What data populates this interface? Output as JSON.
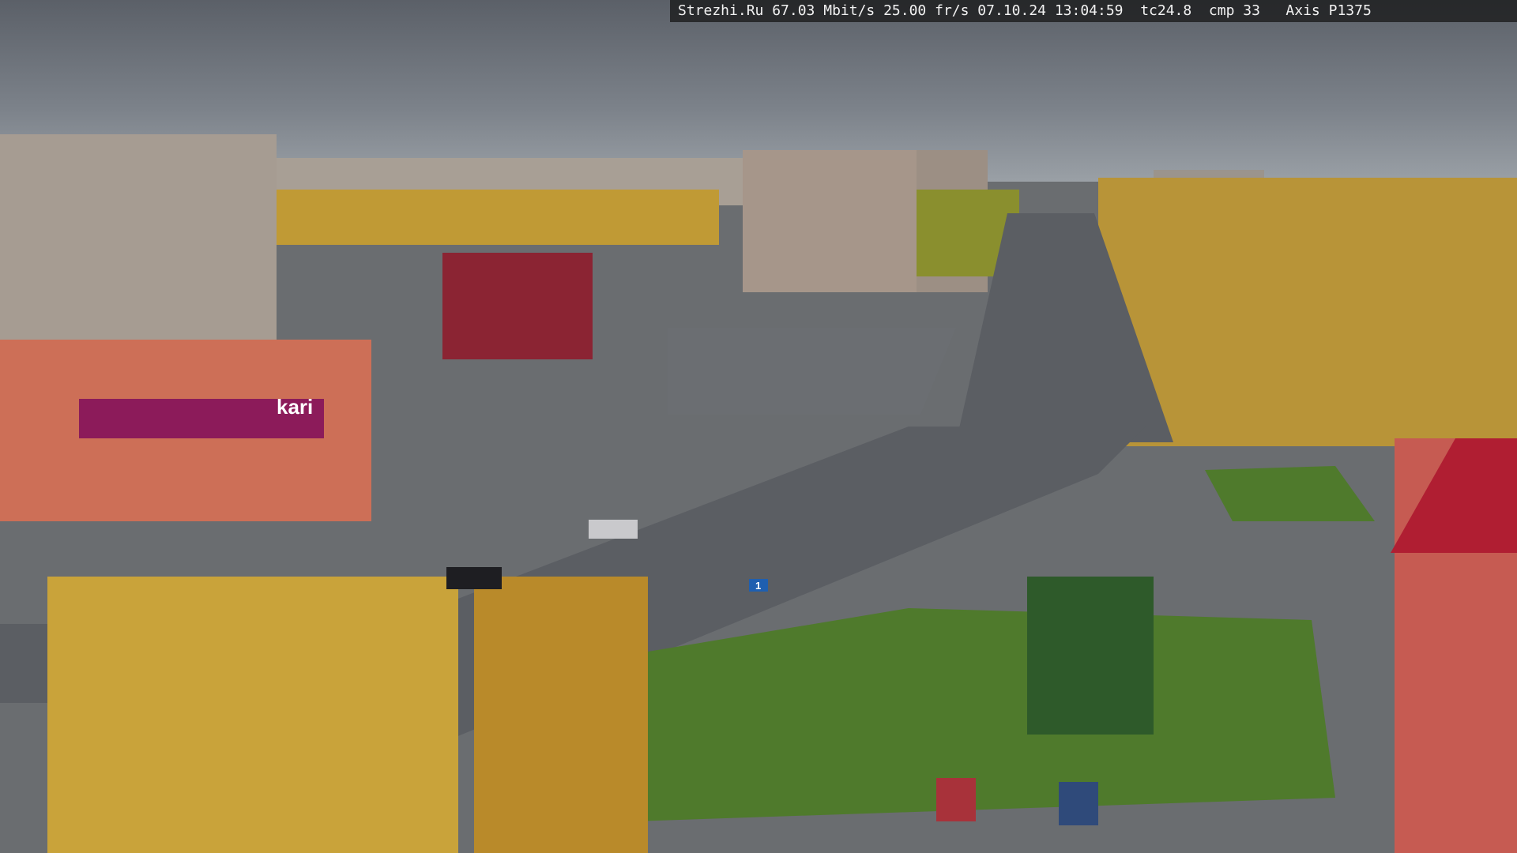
{
  "overlay": {
    "text": "Strezhi.Ru 67.03 Mbit/s 25.00 fr/s 07.10.24 13:04:59  tc24.8  cmp 33   Axis P1375"
  },
  "signs": {
    "store_brand": "kari",
    "route_sign": "1"
  },
  "colors": {
    "sky": "#8a9098",
    "road": "#5b5e63",
    "grass": "#4f7a2c",
    "foliage_yellow": "#c9a33a",
    "store_accent": "#8c1b5a",
    "roof_red": "#b01e32"
  }
}
